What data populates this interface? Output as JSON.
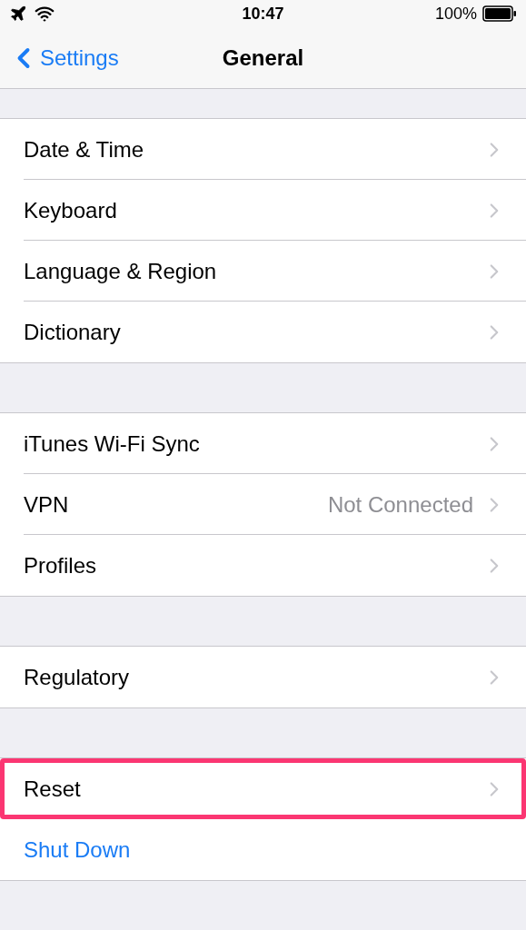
{
  "status_bar": {
    "time": "10:47",
    "battery": "100%"
  },
  "nav": {
    "back": "Settings",
    "title": "General"
  },
  "groups": [
    {
      "rows": [
        {
          "kind": "link",
          "label": "Date & Time",
          "highlighted": false
        },
        {
          "kind": "link",
          "label": "Keyboard",
          "highlighted": false
        },
        {
          "kind": "link",
          "label": "Language & Region",
          "highlighted": false
        },
        {
          "kind": "link",
          "label": "Dictionary",
          "highlighted": false
        }
      ]
    },
    {
      "rows": [
        {
          "kind": "link",
          "label": "iTunes Wi-Fi Sync",
          "highlighted": false
        },
        {
          "kind": "link",
          "label": "VPN",
          "value": "Not Connected",
          "highlighted": false
        },
        {
          "kind": "link",
          "label": "Profiles",
          "highlighted": false
        }
      ]
    },
    {
      "rows": [
        {
          "kind": "link",
          "label": "Regulatory",
          "highlighted": false
        }
      ]
    },
    {
      "rows": [
        {
          "kind": "link",
          "label": "Reset",
          "highlighted": true
        },
        {
          "kind": "action",
          "label": "Shut Down",
          "highlighted": false
        }
      ]
    }
  ]
}
